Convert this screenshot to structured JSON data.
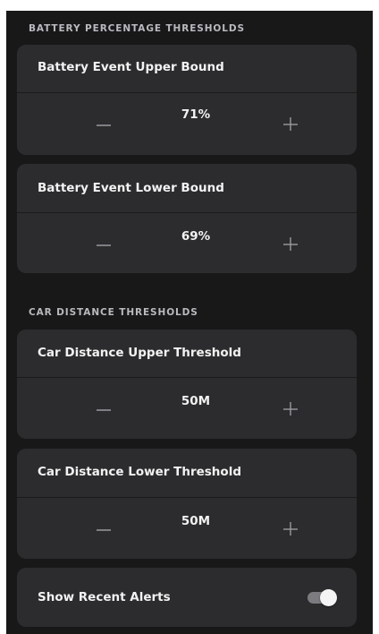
{
  "sections": {
    "battery_header": "BATTERY PERCENTAGE THRESHOLDS",
    "distance_header": "CAR DISTANCE THRESHOLDS"
  },
  "battery_upper": {
    "title": "Battery Event Upper Bound",
    "value": "71%"
  },
  "battery_lower": {
    "title": "Battery Event Lower Bound",
    "value": "69%"
  },
  "distance_upper": {
    "title": "Car Distance Upper Threshold",
    "value": "50M"
  },
  "distance_lower": {
    "title": "Car Distance Lower Threshold",
    "value": "50M"
  },
  "alerts": {
    "label": "Show Recent Alerts",
    "enabled": true
  },
  "icons": {
    "decrement": "minus-icon",
    "increment": "plus-icon"
  },
  "colors": {
    "background": "#181819",
    "card": "#2c2c2e",
    "text": "#f2f2f2",
    "section_text": "#b9b9bf",
    "icon": "#9a9aa0",
    "toggle_track": "#7c7c80",
    "toggle_knob": "#f4f4f4"
  }
}
